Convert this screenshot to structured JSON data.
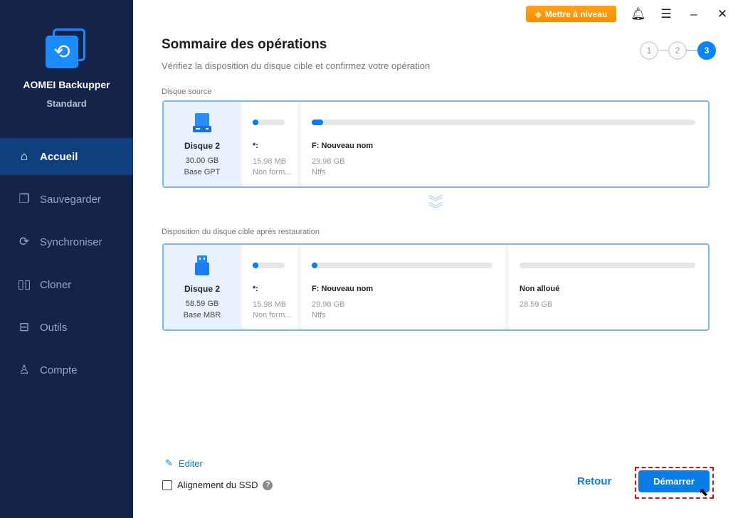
{
  "app": {
    "name": "AOMEI Backupper",
    "edition": "Standard"
  },
  "sidebar": {
    "items": [
      {
        "label": "Accueil",
        "icon": "home-icon",
        "active": true
      },
      {
        "label": "Sauvegarder",
        "icon": "backup-icon"
      },
      {
        "label": "Synchroniser",
        "icon": "sync-icon"
      },
      {
        "label": "Cloner",
        "icon": "clone-icon"
      },
      {
        "label": "Outils",
        "icon": "tools-icon"
      },
      {
        "label": "Compte",
        "icon": "account-icon"
      }
    ]
  },
  "topbar": {
    "upgrade_label": "Mettre à niveau"
  },
  "header": {
    "title": "Sommaire des opérations",
    "subtitle": "Vérifiez la disposition du disque cible et confirmez votre opération",
    "steps": [
      "1",
      "2",
      "3"
    ],
    "current_step": 3
  },
  "source": {
    "label": "Disque source",
    "disk": {
      "name": "Disque 2",
      "size": "30.00 GB",
      "type": "Base GPT"
    },
    "partitions": [
      {
        "name": "*:",
        "size": "15.98 MB",
        "fs": "Non form...",
        "fill": 0.05
      },
      {
        "name": "F: Nouveau nom",
        "size": "29.98 GB",
        "fs": "Ntfs",
        "fill": 0.02
      }
    ]
  },
  "target": {
    "label": "Disposition du disque cible après restauration",
    "disk": {
      "name": "Disque 2",
      "size": "58.59 GB",
      "type": "Base MBR"
    },
    "partitions": [
      {
        "name": "*:",
        "size": "15.98 MB",
        "fs": "Non form...",
        "fill": 0.05
      },
      {
        "name": "F: Nouveau nom",
        "size": "29.98 GB",
        "fs": "Ntfs",
        "fill": 0.02
      },
      {
        "name": "Non alloué",
        "size": "28.59 GB",
        "fill": 0
      }
    ]
  },
  "footer": {
    "edit_label": "Editer",
    "ssd_label": "Alignement du SSD",
    "ssd_checked": false,
    "help": "?",
    "back_label": "Retour",
    "start_label": "Démarrer"
  },
  "colors": {
    "accent": "#0a7ce8",
    "sidebar": "#13234a",
    "upgrade": "#ff8a00",
    "highlight": "#e01010"
  }
}
